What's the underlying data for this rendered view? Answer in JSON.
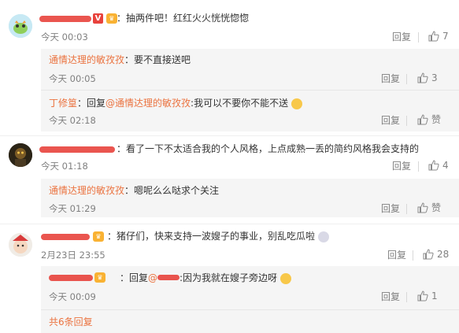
{
  "colors": {
    "accent": "#eb7340",
    "muted": "#808080",
    "redaction": "#e8423c",
    "panel": "#f5f5f5"
  },
  "comments": [
    {
      "text": "：抽两件吧！红红火火恍恍惚惚",
      "time": "今天 00:03",
      "reply": "回复",
      "likes": "7",
      "subs": [
        {
          "user": "通情达理的敏孜孜",
          "text": "：要不直接送吧",
          "time": "今天 00:05",
          "reply": "回复",
          "likes": "3"
        },
        {
          "user": "丁修篁",
          "pre": "：回复",
          "mention": "@通情达理的敏孜孜",
          "text": ":我可以不要你不能不送",
          "time": "今天 02:18",
          "reply": "回复",
          "likes": "赞"
        }
      ]
    },
    {
      "text": "：看了一下不太适合我的个人风格，上点成熟一丢的简约风格我会支持的",
      "time": "今天 01:18",
      "reply": "回复",
      "likes": "4",
      "subs": [
        {
          "user": "通情达理的敏孜孜",
          "text": "：嗯呢么么哒求个关注",
          "time": "今天 01:29",
          "reply": "回复",
          "likes": "赞"
        }
      ]
    },
    {
      "text": "：猪仔们，快来支持一波嫂子的事业，别乱吃瓜啦",
      "time": "2月23日 23:55",
      "reply": "回复",
      "likes": "28",
      "subs": [
        {
          "pre": "：回复",
          "text": ":因为我就在嫂子旁边呀",
          "time": "今天 00:09",
          "reply": "回复",
          "likes": "1"
        }
      ]
    }
  ],
  "footer": {
    "more": "共6条回复"
  }
}
